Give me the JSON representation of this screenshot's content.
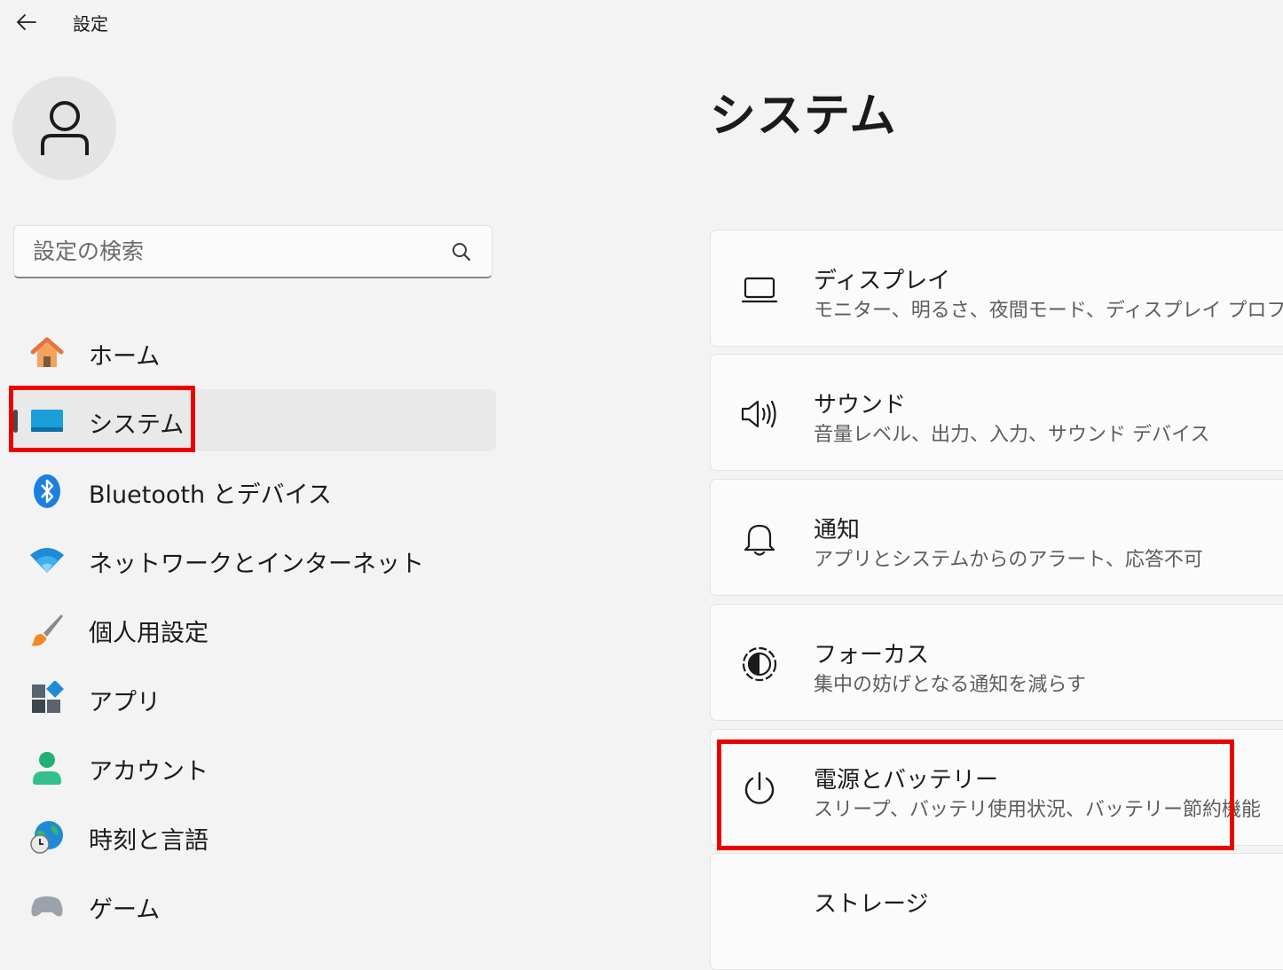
{
  "window": {
    "title": "設定"
  },
  "search": {
    "placeholder": "設定の検索"
  },
  "sidebar": {
    "items": [
      {
        "label": "ホーム"
      },
      {
        "label": "システム"
      },
      {
        "label": "Bluetooth とデバイス"
      },
      {
        "label": "ネットワークとインターネット"
      },
      {
        "label": "個人用設定"
      },
      {
        "label": "アプリ"
      },
      {
        "label": "アカウント"
      },
      {
        "label": "時刻と言語"
      },
      {
        "label": "ゲーム"
      }
    ]
  },
  "main": {
    "title": "システム",
    "cards": [
      {
        "title": "ディスプレイ",
        "description": "モニター、明るさ、夜間モード、ディスプレイ プロファイル",
        "icon": "display-icon"
      },
      {
        "title": "サウンド",
        "description": "音量レベル、出力、入力、サウンド デバイス",
        "icon": "speaker-icon"
      },
      {
        "title": "通知",
        "description": "アプリとシステムからのアラート、応答不可",
        "icon": "bell-icon"
      },
      {
        "title": "フォーカス",
        "description": "集中の妨げとなる通知を減らす",
        "icon": "focus-icon"
      },
      {
        "title": "電源とバッテリー",
        "description": "スリープ、バッテリ使用状況、バッテリー節約機能",
        "icon": "power-icon"
      },
      {
        "title": "ストレージ",
        "description": "",
        "icon": "storage-icon"
      }
    ]
  },
  "colors": {
    "accent": "#0067c0",
    "highlight": "#ec0000",
    "background": "#f3f3f3",
    "card": "#fbfbfb"
  }
}
